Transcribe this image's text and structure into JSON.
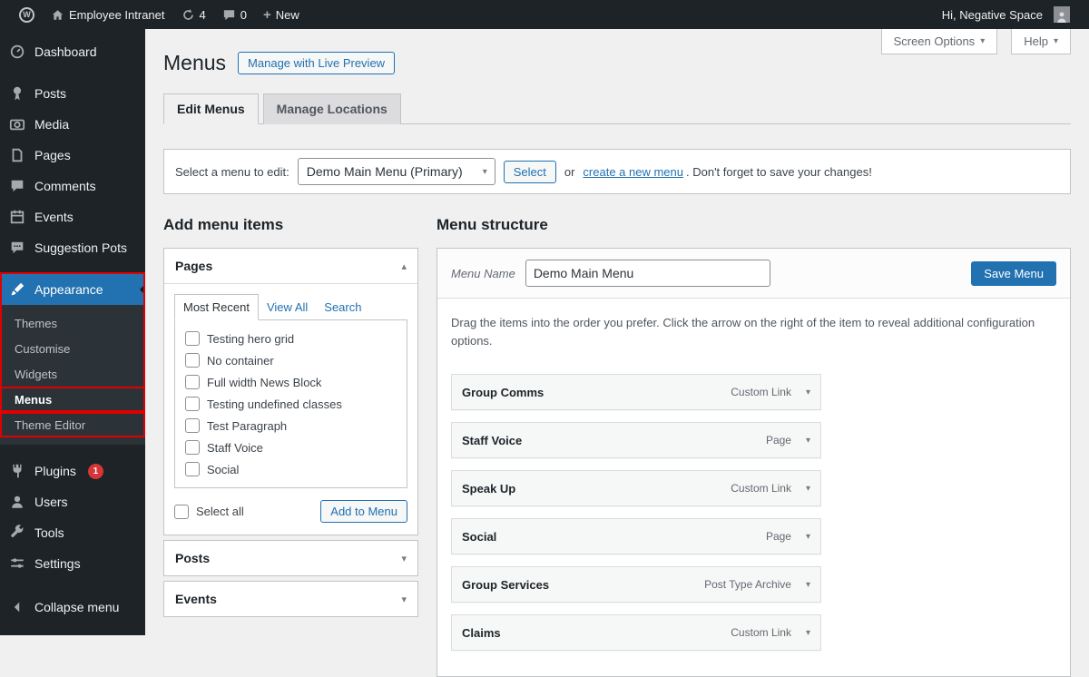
{
  "colors": {
    "accent": "#2271b1",
    "annotation_red": "#e10000",
    "badge_red": "#d63638"
  },
  "admin_bar": {
    "site_name": "Employee Intranet",
    "updates_count": "4",
    "comments_count": "0",
    "new_label": "New",
    "greeting": "Hi, Negative Space"
  },
  "sidebar": {
    "items": [
      {
        "label": "Dashboard"
      },
      {
        "label": "Posts"
      },
      {
        "label": "Media"
      },
      {
        "label": "Pages"
      },
      {
        "label": "Comments"
      },
      {
        "label": "Events"
      },
      {
        "label": "Suggestion Pots"
      },
      {
        "label": "Appearance"
      },
      {
        "label": "Plugins",
        "badge": "1"
      },
      {
        "label": "Users"
      },
      {
        "label": "Tools"
      },
      {
        "label": "Settings"
      },
      {
        "label": "Collapse menu"
      }
    ],
    "appearance_submenu": [
      {
        "label": "Themes"
      },
      {
        "label": "Customise"
      },
      {
        "label": "Widgets"
      },
      {
        "label": "Menus"
      },
      {
        "label": "Theme Editor"
      }
    ]
  },
  "header": {
    "title": "Menus",
    "live_preview_button": "Manage with Live Preview",
    "screen_options": "Screen Options",
    "help": "Help"
  },
  "tabs": {
    "edit_menus": "Edit Menus",
    "manage_locations": "Manage Locations"
  },
  "menu_select": {
    "label": "Select a menu to edit:",
    "selected_option": "Demo Main Menu (Primary)",
    "select_button": "Select",
    "or_text": "or",
    "create_link": "create a new menu",
    "suffix_text": ". Don't forget to save your changes!"
  },
  "add_menu_items": {
    "heading": "Add menu items",
    "pages_panel": {
      "title": "Pages",
      "tabs": [
        {
          "label": "Most Recent"
        },
        {
          "label": "View All"
        },
        {
          "label": "Search"
        }
      ],
      "checkbox_items": [
        {
          "label": "Testing hero grid"
        },
        {
          "label": "No container"
        },
        {
          "label": "Full width News Block"
        },
        {
          "label": "Testing undefined classes"
        },
        {
          "label": "Test Paragraph"
        },
        {
          "label": "Staff Voice"
        },
        {
          "label": "Social"
        }
      ],
      "select_all_label": "Select all",
      "add_button": "Add to Menu"
    },
    "posts_panel_title": "Posts",
    "events_panel_title": "Events"
  },
  "menu_structure": {
    "heading": "Menu structure",
    "menu_name_label": "Menu Name",
    "menu_name_value": "Demo Main Menu",
    "save_button": "Save Menu",
    "instructions": "Drag the items into the order you prefer. Click the arrow on the right of the item to reveal additional configuration options.",
    "items": [
      {
        "label": "Group Comms",
        "type": "Custom Link"
      },
      {
        "label": "Staff Voice",
        "type": "Page"
      },
      {
        "label": "Speak Up",
        "type": "Custom Link"
      },
      {
        "label": "Social",
        "type": "Page"
      },
      {
        "label": "Group Services",
        "type": "Post Type Archive"
      },
      {
        "label": "Claims",
        "type": "Custom Link"
      }
    ]
  }
}
